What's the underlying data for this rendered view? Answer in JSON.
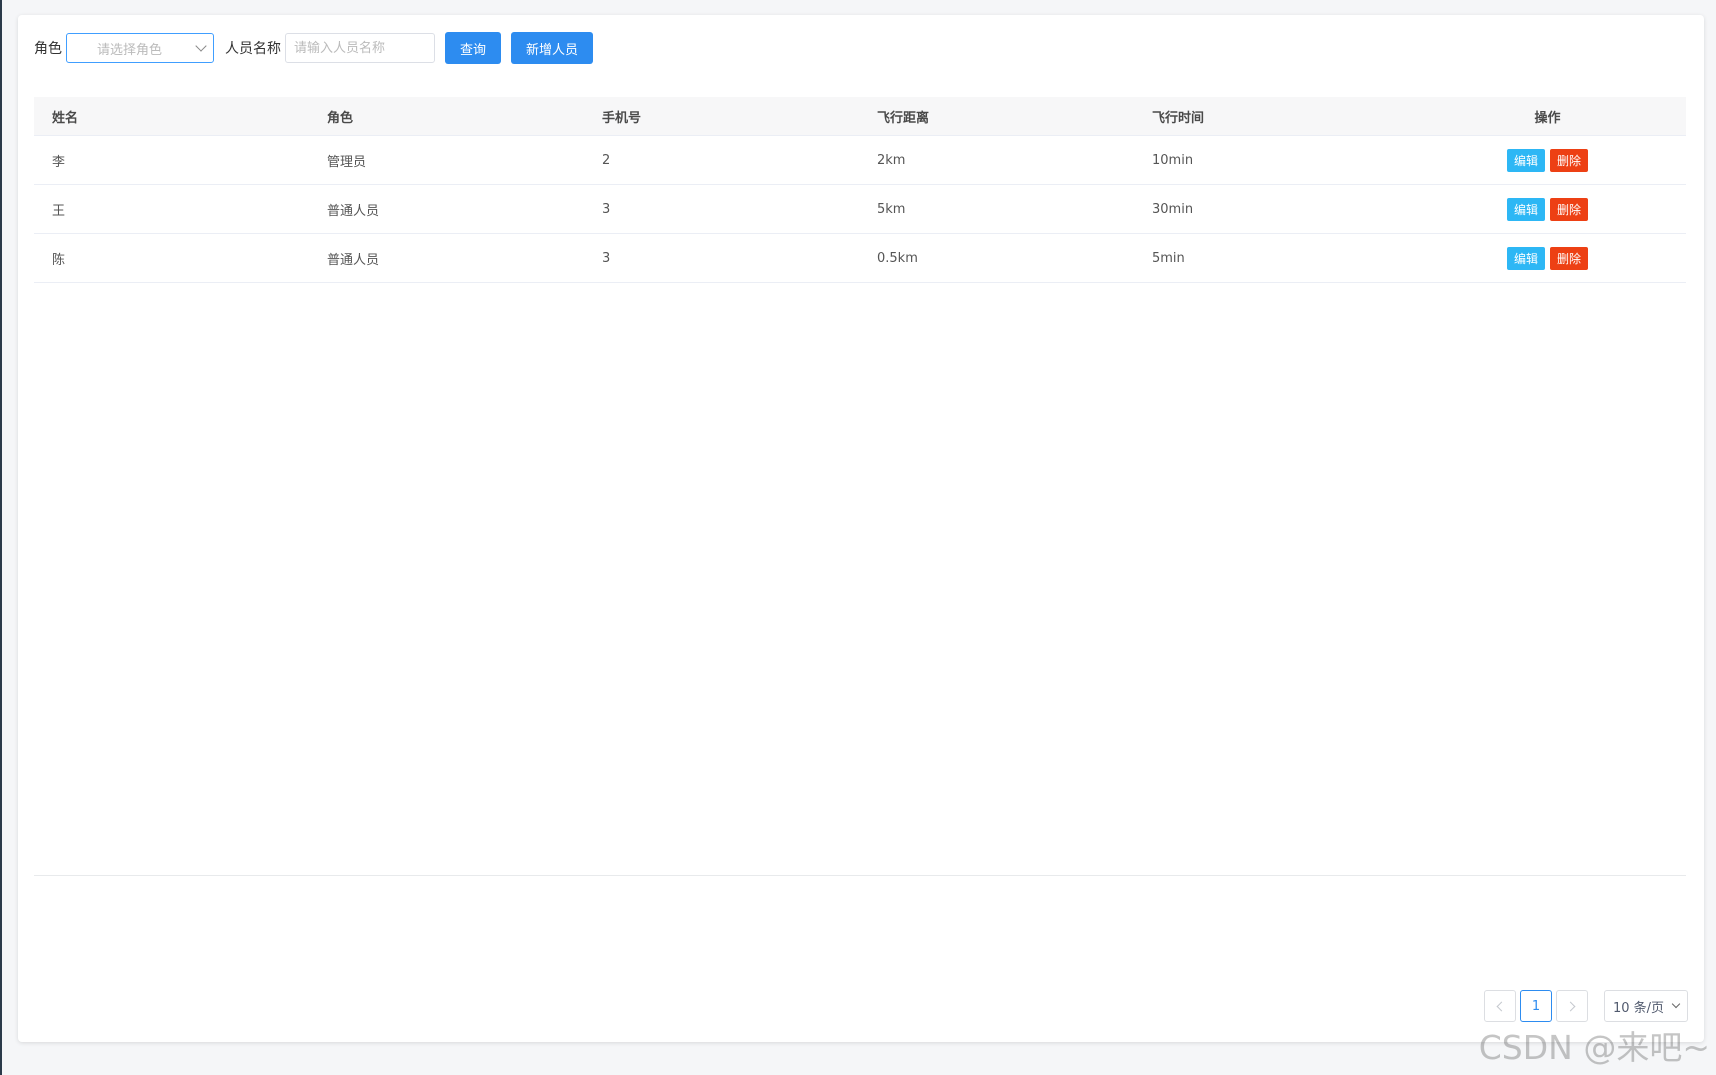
{
  "filters": {
    "role_label": "角色",
    "role_placeholder": "请选择角色",
    "name_label": "人员名称",
    "name_placeholder": "请输入人员名称",
    "query_label": "查询",
    "add_label": "新增人员"
  },
  "table": {
    "columns": [
      "姓名",
      "角色",
      "手机号",
      "飞行距离",
      "飞行时间",
      "操作"
    ],
    "rows": [
      {
        "name": "李",
        "role": "管理员",
        "phone": "2",
        "distance": "2km",
        "time": "10min"
      },
      {
        "name": "王",
        "role": "普通人员",
        "phone": "3",
        "distance": "5km",
        "time": "30min"
      },
      {
        "name": "陈",
        "role": "普通人员",
        "phone": "3",
        "distance": "0.5km",
        "time": "5min"
      }
    ],
    "edit_label": "编辑",
    "delete_label": "删除"
  },
  "pagination": {
    "current_page": "1",
    "page_size": "10 条/页"
  },
  "watermark": "CSDN @来吧~",
  "colors": {
    "primary": "#2d8cf0",
    "edit": "#2db7f5",
    "delete": "#ed4014"
  }
}
